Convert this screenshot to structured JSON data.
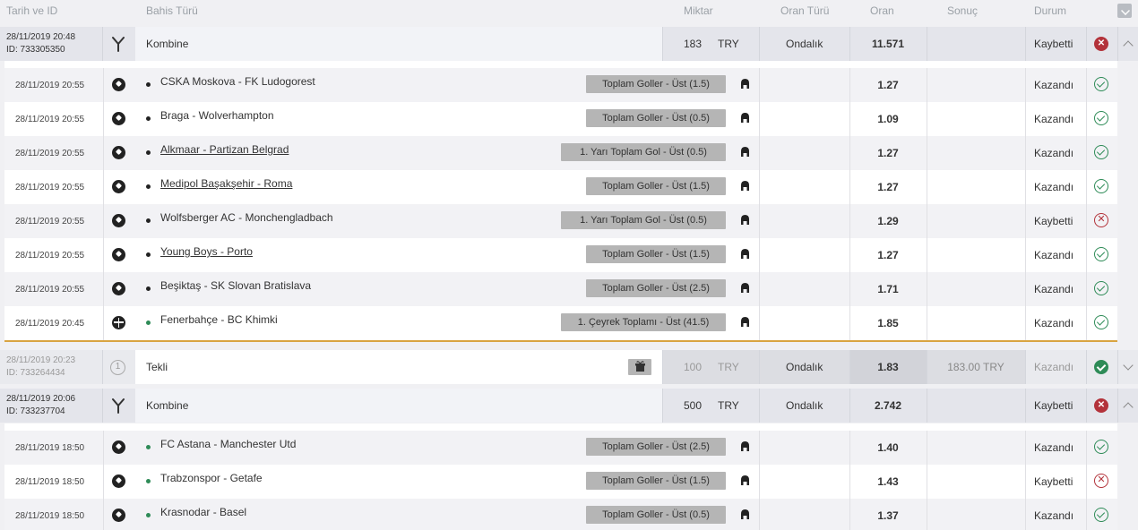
{
  "header": {
    "date_id": "Tarih ve ID",
    "bet_type": "Bahis Türü",
    "amount": "Miktar",
    "odds_type": "Oran Türü",
    "odds": "Oran",
    "result": "Sonuç",
    "status": "Durum"
  },
  "bets": [
    {
      "date": "28/11/2019 20:48",
      "id": "ID: 733305350",
      "type": "Kombine",
      "amount": "183",
      "currency": "TRY",
      "odds_type": "Ondalık",
      "odds": "11.571",
      "result": "",
      "status": "Kaybetti",
      "selections": [
        {
          "date": "28/11/2019 20:55",
          "sport": "football",
          "match": "CSKA Moskova - FK Ludogorest",
          "underline": false,
          "market": "Toplam Goller - Üst (1.5)",
          "odds": "1.27",
          "status": "Kazandı",
          "won": true
        },
        {
          "date": "28/11/2019 20:55",
          "sport": "football",
          "match": "Braga - Wolverhampton",
          "underline": false,
          "market": "Toplam Goller - Üst (0.5)",
          "odds": "1.09",
          "status": "Kazandı",
          "won": true
        },
        {
          "date": "28/11/2019 20:55",
          "sport": "football",
          "match": "Alkmaar - Partizan Belgrad",
          "underline": true,
          "market": "1. Yarı Toplam Gol - Üst (0.5)",
          "odds": "1.27",
          "status": "Kazandı",
          "won": true
        },
        {
          "date": "28/11/2019 20:55",
          "sport": "football",
          "match": "Medipol Başakşehir - Roma",
          "underline": true,
          "market": "Toplam Goller - Üst (1.5)",
          "odds": "1.27",
          "status": "Kazandı",
          "won": true
        },
        {
          "date": "28/11/2019 20:55",
          "sport": "football",
          "match": "Wolfsberger AC - Monchengladbach",
          "underline": false,
          "market": "1. Yarı Toplam Gol - Üst (0.5)",
          "odds": "1.29",
          "status": "Kaybetti",
          "won": false
        },
        {
          "date": "28/11/2019 20:55",
          "sport": "football",
          "match": "Young Boys - Porto",
          "underline": true,
          "market": "Toplam Goller - Üst (1.5)",
          "odds": "1.27",
          "status": "Kazandı",
          "won": true
        },
        {
          "date": "28/11/2019 20:55",
          "sport": "football",
          "match": "Beşiktaş - SK Slovan Bratislava",
          "underline": false,
          "market": "Toplam Goller - Üst (2.5)",
          "odds": "1.71",
          "status": "Kazandı",
          "won": true
        },
        {
          "date": "28/11/2019 20:45",
          "sport": "basketball",
          "match": "Fenerbahçe - BC Khimki",
          "underline": false,
          "market": "1. Çeyrek Toplamı - Üst (41.5)",
          "odds": "1.85",
          "status": "Kazandı",
          "won": true
        }
      ]
    },
    {
      "date": "28/11/2019 20:23",
      "id": "ID: 733264434",
      "type": "Tekli",
      "amount": "100",
      "currency": "TRY",
      "odds_type": "Ondalık",
      "odds": "1.83",
      "result": "183.00 TRY",
      "status": "Kazandı",
      "single_number": "1",
      "selections": []
    },
    {
      "date": "28/11/2019 20:06",
      "id": "ID: 733237704",
      "type": "Kombine",
      "amount": "500",
      "currency": "TRY",
      "odds_type": "Ondalık",
      "odds": "2.742",
      "result": "",
      "status": "Kaybetti",
      "selections": [
        {
          "date": "28/11/2019 18:50",
          "sport": "football",
          "match": "FC Astana - Manchester Utd",
          "underline": false,
          "market": "Toplam Goller - Üst (2.5)",
          "odds": "1.40",
          "status": "Kazandı",
          "won": true
        },
        {
          "date": "28/11/2019 18:50",
          "sport": "football",
          "match": "Trabzonspor - Getafe",
          "underline": false,
          "market": "Toplam Goller - Üst (1.5)",
          "odds": "1.43",
          "status": "Kaybetti",
          "won": false
        },
        {
          "date": "28/11/2019 18:50",
          "sport": "football",
          "match": "Krasnodar - Basel",
          "underline": false,
          "market": "Toplam Goller - Üst (0.5)",
          "odds": "1.37",
          "status": "Kazandı",
          "won": true
        }
      ]
    }
  ],
  "colors": {
    "win": "#2e8b57",
    "loss": "#b3323a",
    "accent": "#d9a441"
  }
}
